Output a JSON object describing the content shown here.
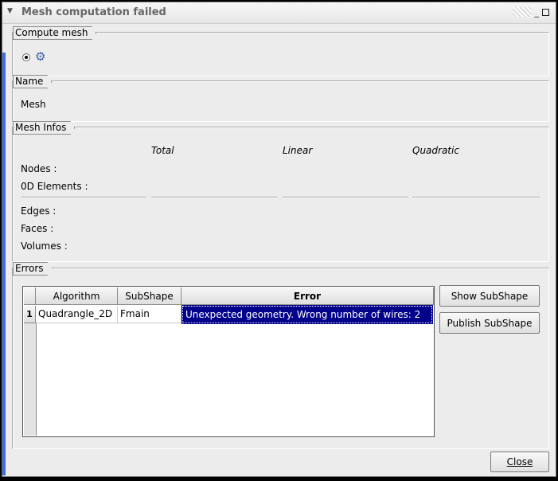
{
  "window": {
    "title": "Mesh computation failed"
  },
  "compute_mesh": {
    "group_label": "Compute mesh"
  },
  "name": {
    "group_label": "Name",
    "value": "Mesh"
  },
  "mesh_infos": {
    "group_label": "Mesh Infos",
    "columns": {
      "total": "Total",
      "linear": "Linear",
      "quadratic": "Quadratic"
    },
    "rows": {
      "nodes": "Nodes :",
      "elements_0d": "0D Elements :",
      "edges": "Edges :",
      "faces": "Faces :",
      "volumes": "Volumes :"
    }
  },
  "errors": {
    "group_label": "Errors",
    "columns": [
      "Algorithm",
      "SubShape",
      "Error"
    ],
    "rows": [
      {
        "index": "1",
        "algorithm": "Quadrangle_2D",
        "subshape": "Fmain",
        "error": "Unexpected geometry. Wrong number of wires: 2"
      }
    ],
    "show_subshape_label": "Show SubShape",
    "publish_subshape_label": "Publish SubShape"
  },
  "footer": {
    "close_label": "Close"
  },
  "colors": {
    "selection": "#00008b",
    "accent_bar": "#3f6fd6"
  }
}
